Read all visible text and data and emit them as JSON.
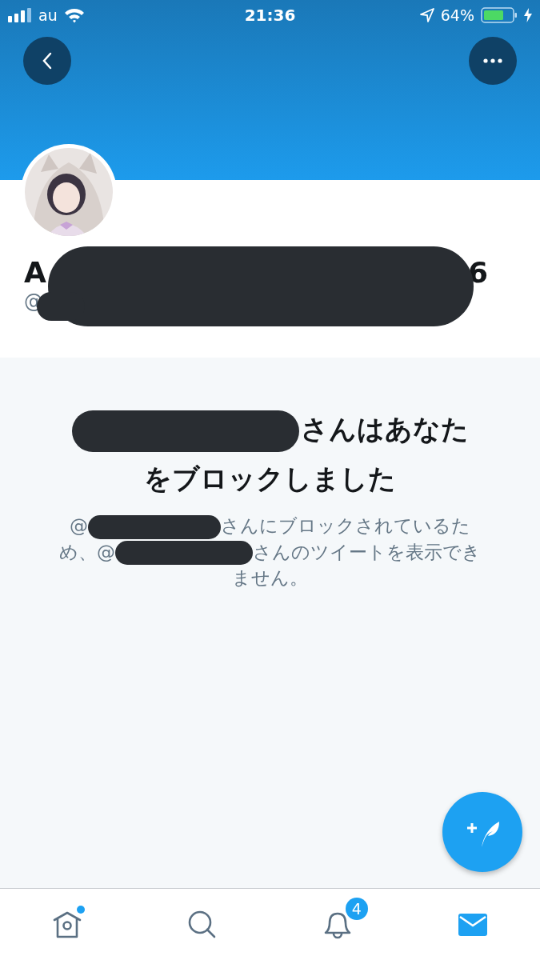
{
  "status_bar": {
    "carrier": "au",
    "time": "21:36",
    "battery": "64%"
  },
  "profile": {
    "name_start": "A",
    "name_end": "6",
    "handle_start": "@"
  },
  "blocked_notice": {
    "heading_lines": [
      "さんはあなた",
      "をブロックしました"
    ],
    "body_lines": [
      [
        "@",
        "さんにブロックされているた"
      ],
      [
        "め、@",
        "さんのツイートを表示でき"
      ],
      [
        "ません。"
      ]
    ]
  },
  "tab_bar": [
    {
      "kind": "home",
      "selected": false,
      "has_dot": true
    },
    {
      "kind": "search",
      "selected": false
    },
    {
      "kind": "notifications",
      "selected": false,
      "badge": "4"
    },
    {
      "kind": "messages",
      "selected": true
    }
  ]
}
